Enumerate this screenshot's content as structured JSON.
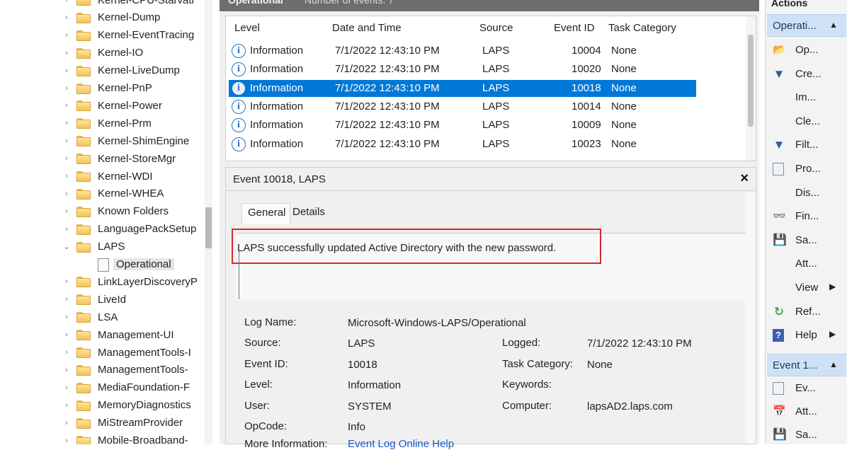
{
  "tree": {
    "items": [
      {
        "label": "Kernel-CPU-Starvati",
        "expander": "›",
        "child": false
      },
      {
        "label": "Kernel-Dump",
        "expander": "›",
        "child": false
      },
      {
        "label": "Kernel-EventTracing",
        "expander": "›",
        "child": false
      },
      {
        "label": "Kernel-IO",
        "expander": "›",
        "child": false
      },
      {
        "label": "Kernel-LiveDump",
        "expander": "›",
        "child": false
      },
      {
        "label": "Kernel-PnP",
        "expander": "›",
        "child": false
      },
      {
        "label": "Kernel-Power",
        "expander": "›",
        "child": false
      },
      {
        "label": "Kernel-Prm",
        "expander": "›",
        "child": false
      },
      {
        "label": "Kernel-ShimEngine",
        "expander": "›",
        "child": false
      },
      {
        "label": "Kernel-StoreMgr",
        "expander": "›",
        "child": false
      },
      {
        "label": "Kernel-WDI",
        "expander": "›",
        "child": false
      },
      {
        "label": "Kernel-WHEA",
        "expander": "›",
        "child": false
      },
      {
        "label": "Known Folders",
        "expander": "›",
        "child": false
      },
      {
        "label": "LanguagePackSetup",
        "expander": "›",
        "child": false
      },
      {
        "label": "LAPS",
        "expander": "⌄",
        "child": false
      },
      {
        "label": "Operational",
        "expander": "",
        "child": true,
        "selected": true
      },
      {
        "label": "LinkLayerDiscoveryP",
        "expander": "›",
        "child": false
      },
      {
        "label": "LiveId",
        "expander": "›",
        "child": false
      },
      {
        "label": "LSA",
        "expander": "›",
        "child": false
      },
      {
        "label": "Management-UI",
        "expander": "›",
        "child": false
      },
      {
        "label": "ManagementTools-I",
        "expander": "›",
        "child": false
      },
      {
        "label": "ManagementTools-",
        "expander": "›",
        "child": false
      },
      {
        "label": "MediaFoundation-F",
        "expander": "›",
        "child": false
      },
      {
        "label": "MemoryDiagnostics",
        "expander": "›",
        "child": false
      },
      {
        "label": "MiStreamProvider",
        "expander": "›",
        "child": false
      },
      {
        "label": "Mobile-Broadband-",
        "expander": "›",
        "child": false
      }
    ]
  },
  "middle": {
    "header_title": "Operational",
    "header_count": "Number of events: 7",
    "columns": {
      "level": "Level",
      "date": "Date and Time",
      "source": "Source",
      "event_id": "Event ID",
      "task": "Task Category"
    },
    "rows": [
      {
        "level": "Information",
        "date": "7/1/2022 12:43:10 PM",
        "source": "LAPS",
        "event_id": "10004",
        "task": "None",
        "selected": false
      },
      {
        "level": "Information",
        "date": "7/1/2022 12:43:10 PM",
        "source": "LAPS",
        "event_id": "10020",
        "task": "None",
        "selected": false
      },
      {
        "level": "Information",
        "date": "7/1/2022 12:43:10 PM",
        "source": "LAPS",
        "event_id": "10018",
        "task": "None",
        "selected": true
      },
      {
        "level": "Information",
        "date": "7/1/2022 12:43:10 PM",
        "source": "LAPS",
        "event_id": "10014",
        "task": "None",
        "selected": false
      },
      {
        "level": "Information",
        "date": "7/1/2022 12:43:10 PM",
        "source": "LAPS",
        "event_id": "10009",
        "task": "None",
        "selected": false
      },
      {
        "level": "Information",
        "date": "7/1/2022 12:43:10 PM",
        "source": "LAPS",
        "event_id": "10023",
        "task": "None",
        "selected": false
      }
    ],
    "detail": {
      "title": "Event 10018, LAPS",
      "close": "×",
      "tab_general": "General",
      "tab_details": "Details",
      "message": "LAPS successfully updated Active Directory with the new password.",
      "fields": {
        "log_name_label": "Log Name:",
        "log_name": "Microsoft-Windows-LAPS/Operational",
        "source_label": "Source:",
        "source": "LAPS",
        "logged_label": "Logged:",
        "logged": "7/1/2022 12:43:10 PM",
        "event_id_label": "Event ID:",
        "event_id": "10018",
        "task_label": "Task Category:",
        "task": "None",
        "level_label": "Level:",
        "level": "Information",
        "keywords_label": "Keywords:",
        "keywords": "",
        "user_label": "User:",
        "user": "SYSTEM",
        "computer_label": "Computer:",
        "computer": "lapsAD2.laps.com",
        "opcode_label": "OpCode:",
        "opcode": "Info",
        "more_info_label": "More Information:",
        "more_info_link": "Event Log Online Help"
      }
    }
  },
  "actions": {
    "title": "Actions",
    "section1_label": "Operati...",
    "section1_arrow": "▲",
    "items1": [
      {
        "label": "Op...",
        "icon": "open-saved-log-icon",
        "glyph": "📂",
        "cls": "ic-open",
        "sub": ""
      },
      {
        "label": "Cre...",
        "icon": "create-custom-view-icon",
        "glyph": "▼",
        "cls": "ic-filter",
        "sub": ""
      },
      {
        "label": "Im...",
        "icon": "",
        "glyph": "",
        "cls": "",
        "sub": ""
      },
      {
        "label": "Cle...",
        "icon": "",
        "glyph": "",
        "cls": "",
        "sub": ""
      },
      {
        "label": "Filt...",
        "icon": "filter-icon",
        "glyph": "▼",
        "cls": "ic-filter",
        "sub": ""
      },
      {
        "label": "Pro...",
        "icon": "properties-icon",
        "glyph": "",
        "cls": "ic-props",
        "sub": ""
      },
      {
        "label": "Dis...",
        "icon": "",
        "glyph": "",
        "cls": "",
        "sub": ""
      },
      {
        "label": "Fin...",
        "icon": "find-icon",
        "glyph": "👓",
        "cls": "ic-find",
        "sub": ""
      },
      {
        "label": "Sa...",
        "icon": "save-icon",
        "glyph": "💾",
        "cls": "ic-save",
        "sub": ""
      },
      {
        "label": "Att...",
        "icon": "",
        "glyph": "",
        "cls": "",
        "sub": ""
      },
      {
        "label": "View",
        "icon": "",
        "glyph": "",
        "cls": "",
        "sub": "▶"
      },
      {
        "label": "Ref...",
        "icon": "refresh-icon",
        "glyph": "↻",
        "cls": "ic-refresh",
        "sub": ""
      },
      {
        "label": "Help",
        "icon": "help-icon",
        "glyph": "?",
        "cls": "ic-help",
        "sub": "▶"
      }
    ],
    "section2_label": "Event 1...",
    "section2_arrow": "▲",
    "items2": [
      {
        "label": "Ev...",
        "icon": "event-properties-icon",
        "glyph": "",
        "cls": "ic-props",
        "sub": ""
      },
      {
        "label": "Att...",
        "icon": "attach-task-icon",
        "glyph": "📅",
        "cls": "ic-attach",
        "sub": ""
      },
      {
        "label": "Sa...",
        "icon": "save-icon",
        "glyph": "💾",
        "cls": "ic-save",
        "sub": ""
      }
    ]
  }
}
